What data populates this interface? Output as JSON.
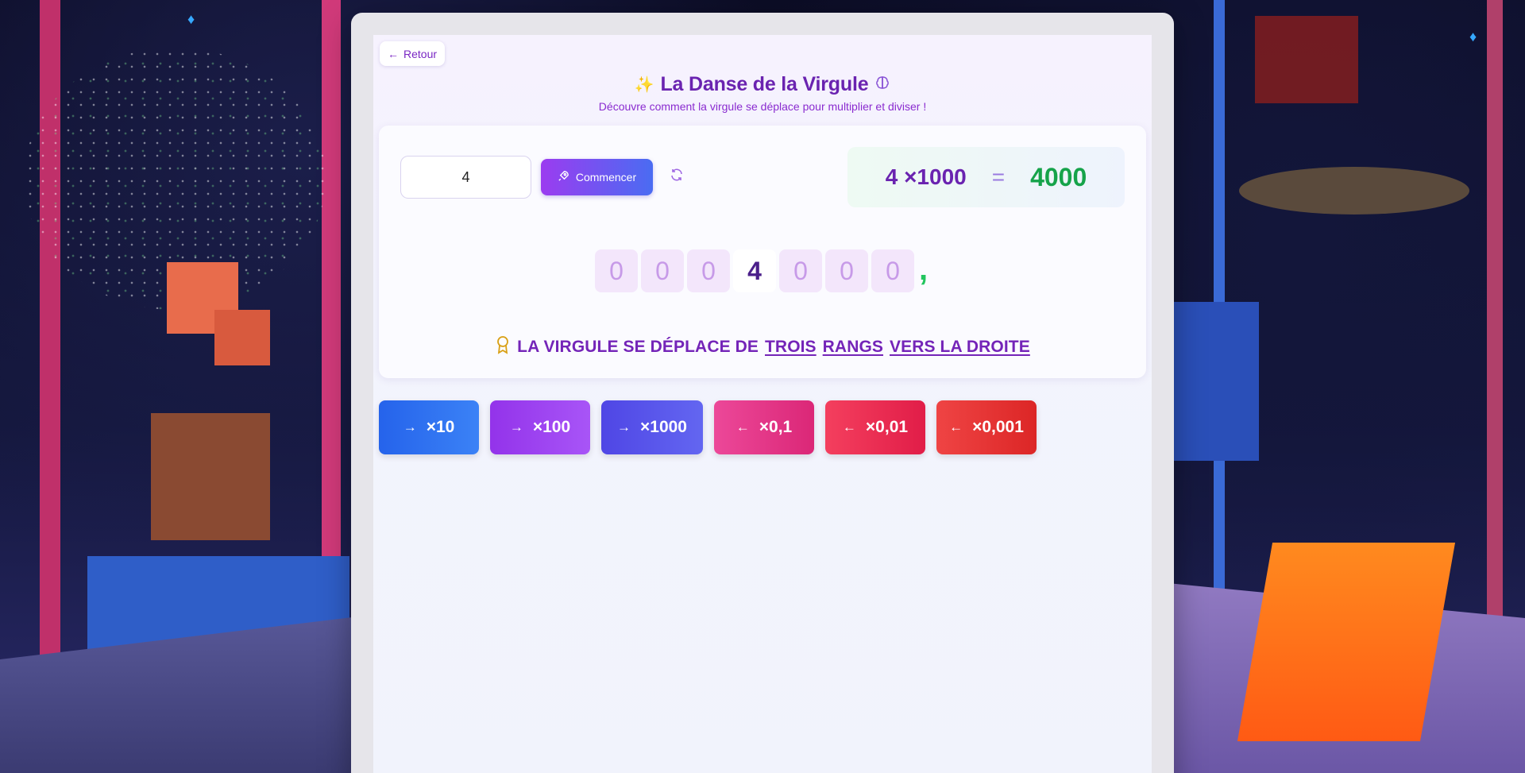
{
  "nav": {
    "back_label": "Retour"
  },
  "header": {
    "title": "La Danse de la Virgule",
    "subtitle": "Découvre comment la virgule se déplace pour multiplier et diviser !"
  },
  "controls": {
    "number_value": "4",
    "start_label": "Commencer"
  },
  "result": {
    "expression": "4 ×1000",
    "equals": "=",
    "value": "4000"
  },
  "digits": [
    "0",
    "0",
    "0",
    "4",
    "0",
    "0",
    "0"
  ],
  "active_digit_index": 3,
  "comma": ",",
  "rule": {
    "prefix": "LA VIRGULE SE DÉPLACE DE",
    "w1": "TROIS",
    "w2": "RANGS",
    "w3": "VERS LA DROITE"
  },
  "operations": [
    {
      "label": "×10",
      "arrow": "→",
      "color_start": "#2563eb",
      "color_end": "#3b82f6"
    },
    {
      "label": "×100",
      "arrow": "→",
      "color_start": "#9333ea",
      "color_end": "#a855f7"
    },
    {
      "label": "×1000",
      "arrow": "→",
      "color_start": "#4f46e5",
      "color_end": "#6366f1"
    },
    {
      "label": "×0,1",
      "arrow": "←",
      "color_start": "#ec4899",
      "color_end": "#db2777"
    },
    {
      "label": "×0,01",
      "arrow": "←",
      "color_start": "#f43f5e",
      "color_end": "#e11d48"
    },
    {
      "label": "×0,001",
      "arrow": "←",
      "color_start": "#ef4444",
      "color_end": "#dc2626"
    }
  ],
  "icons": {
    "back": "arrow-left-icon",
    "title_left": "sparkle-icon",
    "title_right": "brain-icon",
    "start": "rocket-icon",
    "reset": "refresh-icon",
    "rule": "medal-icon"
  },
  "colors": {
    "accent_purple": "#6a23b0",
    "result_green": "#16a34a",
    "comma_green": "#22c55e"
  }
}
